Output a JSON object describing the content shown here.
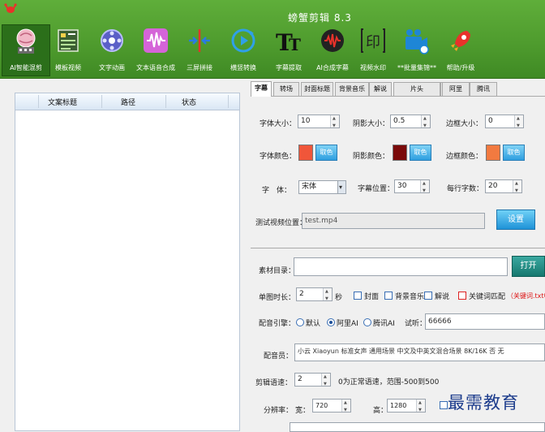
{
  "app": {
    "title": "螃蟹剪辑 8.3"
  },
  "toolbar": {
    "items": [
      {
        "label": "AI智能混剪",
        "icon": "brain-film-icon",
        "active": true
      },
      {
        "label": "模板视频",
        "icon": "template-grid-icon"
      },
      {
        "label": "文字动画",
        "icon": "film-reel-icon"
      },
      {
        "label": "文本语音合成",
        "icon": "audio-wave-icon"
      },
      {
        "label": "三屏拼接",
        "icon": "split-screen-icon"
      },
      {
        "label": "横竖转换",
        "icon": "rotate-play-icon"
      },
      {
        "label": "字幕提取",
        "icon": "text-tt-icon"
      },
      {
        "label": "AI合成字幕",
        "icon": "mic-wave-icon"
      },
      {
        "label": "视频水印",
        "icon": "stamp-icon"
      },
      {
        "label": "**批量集锦**",
        "icon": "camera-batch-icon"
      },
      {
        "label": "帮助/升级",
        "icon": "rocket-icon"
      }
    ]
  },
  "left_table": {
    "columns": [
      "文案标题",
      "路径",
      "状态"
    ]
  },
  "tabs": [
    "字幕",
    "转场",
    "封面标题",
    "背景音乐",
    "解说",
    "片头",
    "",
    "阿里",
    "腾讯"
  ],
  "subtitle": {
    "font_size_label": "字体大小：",
    "font_size": "10",
    "shadow_size_label": "阴影大小：",
    "shadow_size": "0.5",
    "border_size_label": "边框大小：",
    "border_size": "0",
    "font_color_label": "字体颜色：",
    "font_color": "#f0563a",
    "shadow_color_label": "阴影颜色：",
    "shadow_color": "#7a0a0a",
    "border_color_label": "边框颜色：",
    "border_color": "#f27a40",
    "pick_label": "取色",
    "font_label": "字　体：",
    "font_value": "宋体",
    "position_label": "字幕位置：",
    "position_value": "30",
    "per_line_label": "每行字数：",
    "per_line_value": "20",
    "test_video_label": "测试视频位置：",
    "test_video_value": "test.mp4",
    "settings_button": "设置"
  },
  "config": {
    "material_dir_label": "素材目录：",
    "open_button": "打开",
    "duration_label": "单图时长：",
    "duration_value": "2",
    "seconds_unit": "秒",
    "chk_cover": "封面",
    "chk_bgm": "背景音乐",
    "chk_narration": "解说",
    "chk_keyword": "关键词匹配",
    "keyword_note": "（关键词.txt中以",
    "engine_label": "配音引擎：",
    "engine_default": "默认",
    "engine_ali": "阿里AI",
    "engine_tencent": "腾讯AI",
    "listen_label": "试听：",
    "listen_value": "66666",
    "voice_label": "配音员：",
    "voice_value": "小云 Xiaoyun 标准女声 通用场景 中文及中英文混合场景 8K/16K 否 无",
    "speed_label": "剪辑语速：",
    "speed_value": "2",
    "speed_note": "0为正常语速，范围-500到500",
    "resolution_label": "分辨率：",
    "width_label": "宽：",
    "width_value": "720",
    "height_label": "高：",
    "height_value": "1280"
  },
  "watermark": "最需教育"
}
